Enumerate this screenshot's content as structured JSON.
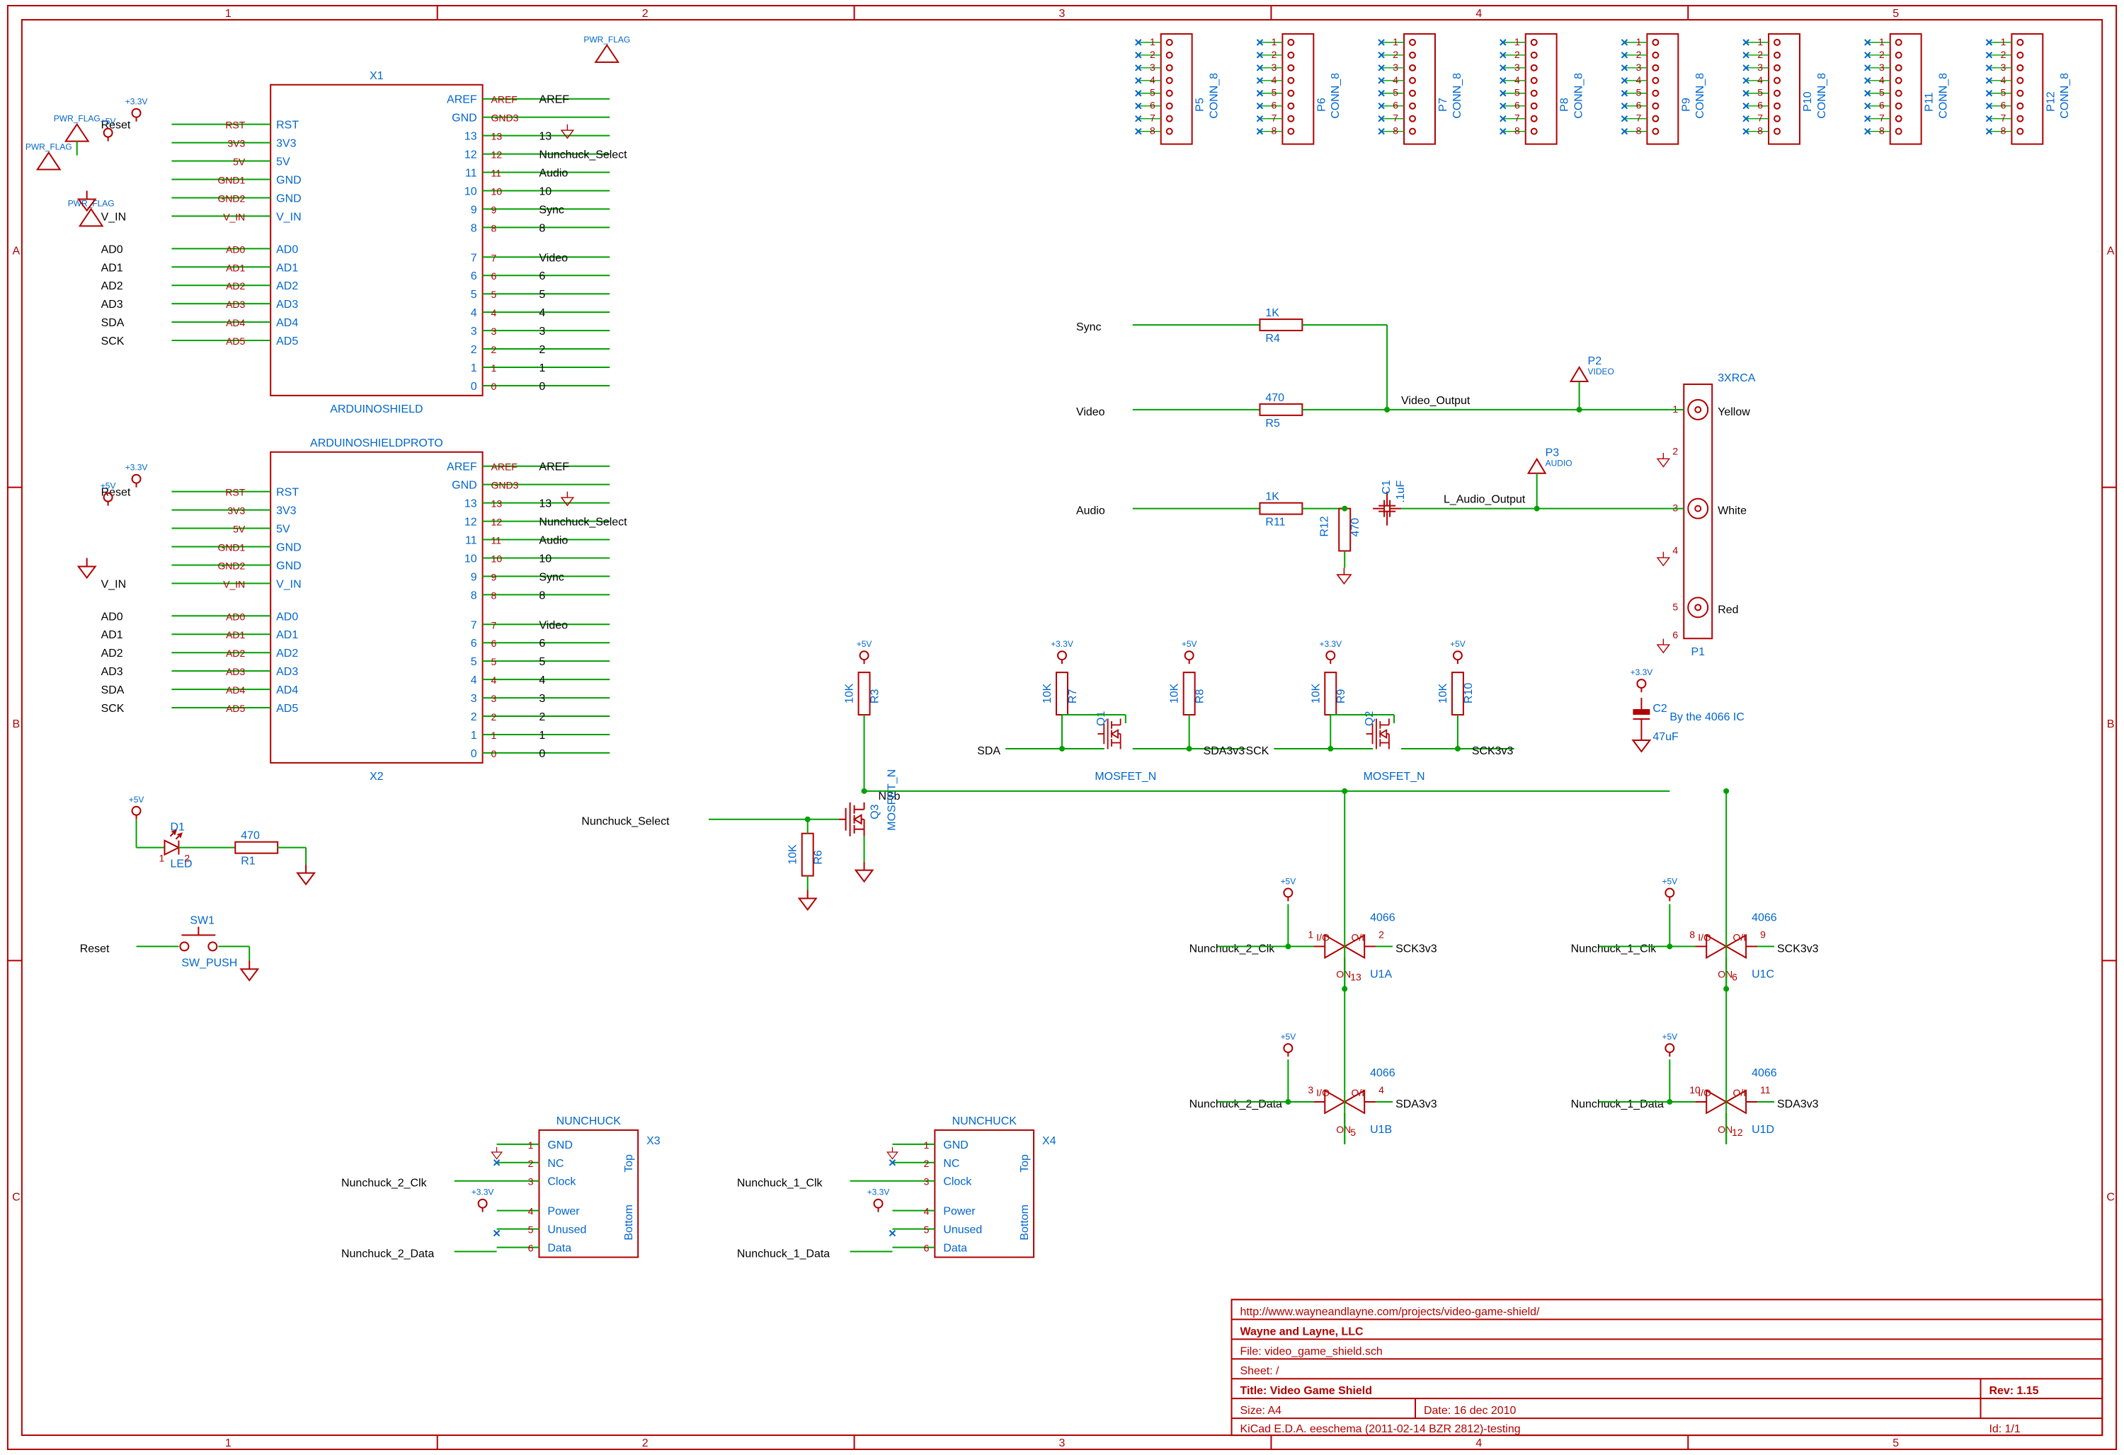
{
  "titleblock": {
    "url": "http://www.wayneandlayne.com/projects/video-game-shield/",
    "company": "Wayne and Layne, LLC",
    "file": "File: video_game_shield.sch",
    "sheet": "Sheet: /",
    "title": "Title: Video Game Shield",
    "size": "Size: A4",
    "date": "Date: 16 dec 2010",
    "rev": "Rev: 1.15",
    "gen": "KiCad E.D.A.  eeschema (2011-02-14 BZR 2812)-testing",
    "id": "Id: 1/1"
  },
  "shield": {
    "ref1": "X1",
    "ref2": "X2",
    "lbl1": "ARDUINOSHIELD",
    "lbl2": "ARDUINOSHIELDPROTO",
    "left": [
      "RST",
      "3V3",
      "5V",
      "GND",
      "GND",
      "V_IN",
      "AD0",
      "AD1",
      "AD2",
      "AD3",
      "AD4",
      "AD5"
    ],
    "left_n": [
      "RST",
      "3V3",
      "5V",
      "GND1",
      "GND2",
      "V_IN",
      "AD0",
      "AD1",
      "AD2",
      "AD3",
      "AD4",
      "AD5"
    ],
    "right": [
      "AREF",
      "GND",
      "13",
      "12",
      "11",
      "10",
      "9",
      "8",
      "7",
      "6",
      "5",
      "4",
      "3",
      "2",
      "1",
      "0"
    ],
    "right_n": [
      "AREF",
      "GND3",
      "13",
      "12",
      "11",
      "10",
      "9",
      "8",
      "7",
      "6",
      "5",
      "4",
      "3",
      "2",
      "1",
      "0"
    ],
    "right_lbl": [
      "AREF",
      "",
      "13",
      "Nunchuck_Select",
      "Audio",
      "10",
      "Sync",
      "8",
      "Video",
      "6",
      "5",
      "4",
      "3",
      "2",
      "1",
      "0"
    ]
  },
  "left_labels": [
    "Reset",
    "",
    "",
    "",
    "",
    "V_IN",
    "AD0",
    "AD1",
    "AD2",
    "AD3",
    "SDA",
    "SCK"
  ],
  "conn": {
    "ref": [
      "P5",
      "P6",
      "P7",
      "P8",
      "P9",
      "P10",
      "P11",
      "P12"
    ],
    "val": "CONN_8",
    "pins": [
      "1",
      "2",
      "3",
      "4",
      "5",
      "6",
      "7",
      "8"
    ]
  },
  "video": {
    "sync": "Sync",
    "vid": "Video",
    "aud": "Audio",
    "vout": "Video_Output",
    "aout": "L_Audio_Output",
    "r4": {
      "ref": "R4",
      "val": "1K"
    },
    "r5": {
      "ref": "R5",
      "val": "470"
    },
    "r11": {
      "ref": "R11",
      "val": "1K"
    },
    "r12": {
      "ref": "R12",
      "val": "470"
    },
    "c1": {
      "ref": "C1",
      "val": ".1uF"
    },
    "p2": {
      "ref": "P2",
      "val": "VIDEO"
    },
    "p3": {
      "ref": "P3",
      "val": "AUDIO"
    },
    "p1": {
      "ref": "P1",
      "val": "3XRCA"
    },
    "rca": [
      "Yellow",
      "White",
      "Red"
    ]
  },
  "levshift": {
    "sda": "SDA",
    "sda3": "SDA3v3",
    "sck": "SCK",
    "sck3": "SCK3v3",
    "q1": {
      "ref": "Q1",
      "val": "MOSFET_N"
    },
    "q2": {
      "ref": "Q2",
      "val": "MOSFET_N"
    },
    "r7": {
      "ref": "R7",
      "val": "10K"
    },
    "r8": {
      "ref": "R8",
      "val": "10K"
    },
    "r9": {
      "ref": "R9",
      "val": "10K"
    },
    "r10": {
      "ref": "R10",
      "val": "10K"
    },
    "c2": {
      "ref": "C2",
      "val": "47uF",
      "note": "By the 4066 IC"
    }
  },
  "nsel": {
    "q3": {
      "ref": "Q3",
      "val": "MOSFET_N"
    },
    "r3": {
      "ref": "R3",
      "val": "10K"
    },
    "r6": {
      "ref": "R6",
      "val": "10K"
    },
    "lbl": "Nunchuck_Select",
    "nsb": "NSb"
  },
  "led": {
    "ref": "D1",
    "val": "LED",
    "r1": {
      "ref": "R1",
      "val": "470"
    }
  },
  "sw": {
    "ref": "SW1",
    "val": "SW_PUSH",
    "net": "Reset"
  },
  "nun": {
    "val": "NUNCHUCK",
    "x3": "X3",
    "x4": "X4",
    "pins": [
      "GND",
      "NC",
      "Clock",
      "Power",
      "Unused",
      "Data"
    ],
    "sides": [
      "Top",
      "Bottom"
    ],
    "clk2": "Nunchuck_2_Clk",
    "dat2": "Nunchuck_2_Data",
    "clk1": "Nunchuck_1_Clk",
    "dat1": "Nunchuck_1_Data"
  },
  "sw4066": {
    "val": "4066",
    "u": [
      "U1A",
      "U1B",
      "U1C",
      "U1D"
    ],
    "n2c": "Nunchuck_2_Clk",
    "n2d": "Nunchuck_2_Data",
    "n1c": "Nunchuck_1_Clk",
    "n1d": "Nunchuck_1_Data",
    "s3": "SCK3v3",
    "d3": "SDA3v3",
    "pinsA": [
      "1",
      "2",
      "13"
    ],
    "pinsB": [
      "3",
      "4",
      "5"
    ],
    "pinsC": [
      "8",
      "9",
      "6"
    ],
    "pinsD": [
      "10",
      "11",
      "12"
    ]
  },
  "pwr": {
    "f": "PWR_FLAG",
    "v5": "+5V",
    "v3": "+3.3V"
  },
  "ruler": {
    "cols": [
      "1",
      "2",
      "3",
      "4",
      "5"
    ],
    "rows": [
      "A",
      "B",
      "C"
    ]
  }
}
